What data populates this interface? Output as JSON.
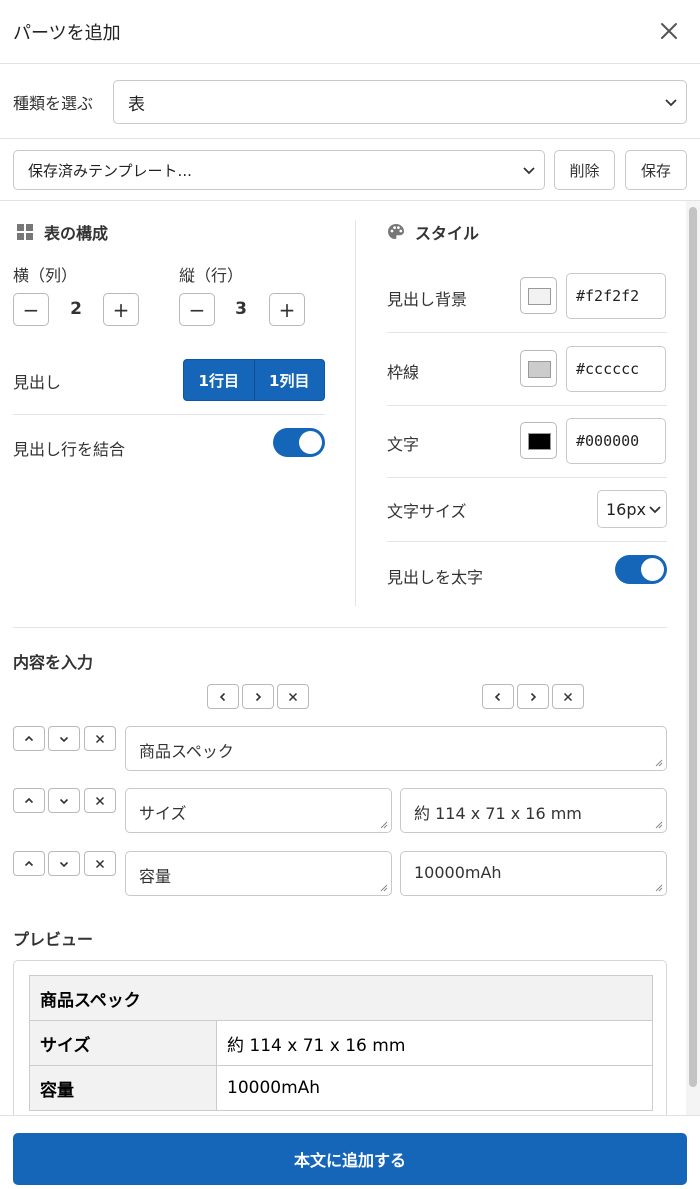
{
  "header": {
    "title": "パーツを追加"
  },
  "type_row": {
    "label": "種類を選ぶ",
    "selected": "表"
  },
  "template_row": {
    "selected": "保存済みテンプレート...",
    "delete_label": "削除",
    "save_label": "保存"
  },
  "structure": {
    "heading": "表の構成",
    "cols_label": "横（列）",
    "cols_value": "2",
    "rows_label": "縦（行）",
    "rows_value": "3",
    "minus": "−",
    "plus": "+",
    "header_label": "見出し",
    "header_options": [
      "1行目",
      "1列目"
    ],
    "merge_label": "見出し行を結合",
    "merge_on": true
  },
  "style": {
    "heading": "スタイル",
    "header_bg_label": "見出し背景",
    "header_bg_value": "#f2f2f2",
    "border_label": "枠線",
    "border_value": "#cccccc",
    "text_label": "文字",
    "text_value": "#000000",
    "size_label": "文字サイズ",
    "size_value": "16px",
    "bold_label": "見出しを太字",
    "bold_on": true
  },
  "content": {
    "heading": "内容を入力",
    "cells": [
      [
        "商品スペック"
      ],
      [
        "サイズ",
        "約 114 x 71 x 16 mm"
      ],
      [
        "容量",
        "10000mAh"
      ]
    ]
  },
  "preview": {
    "heading": "プレビュー",
    "rows": [
      [
        "商品スペック"
      ],
      [
        "サイズ",
        "約 114 x 71 x 16 mm"
      ],
      [
        "容量",
        "10000mAh"
      ]
    ]
  },
  "footer": {
    "submit_label": "本文に追加する"
  },
  "colors": {
    "accent": "#1565b8",
    "header_bg": "#f2f2f2",
    "border": "#cccccc",
    "text": "#000000"
  }
}
